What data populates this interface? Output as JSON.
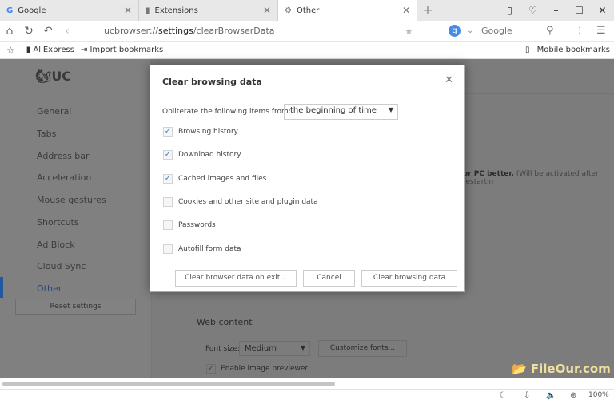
{
  "tabs": [
    {
      "label": "Google",
      "icon": "google-icon"
    },
    {
      "label": "Extensions",
      "icon": "puzzle-icon"
    },
    {
      "label": "Other",
      "icon": "gear-icon",
      "active": true
    }
  ],
  "address": {
    "scheme": "ucbrowser://",
    "path_bold": "settings",
    "path": "/clearBrowserData",
    "search_engine": "Google"
  },
  "bookmarks": {
    "items": [
      "AliExpress",
      "Import bookmarks"
    ],
    "mobile": "Mobile bookmarks"
  },
  "sidebar": {
    "logo": "UC",
    "items": [
      "General",
      "Tabs",
      "Address bar",
      "Acceleration",
      "Mouse gestures",
      "Shortcuts",
      "Ad Block",
      "Cloud Sync",
      "Other"
    ],
    "active": "Other",
    "reset": "Reset settings"
  },
  "background": {
    "note_bold": "or PC better.",
    "note": "(Will be activated after restartin",
    "web_content": "Web content",
    "font_size_label": "Font size:",
    "font_size_value": "Medium",
    "customize_fonts": "Customize fonts...",
    "image_previewer": "Enable image previewer"
  },
  "dialog": {
    "title": "Clear browsing data",
    "obliterate_label": "Obliterate the following items from:",
    "range": "the beginning of time",
    "options": [
      {
        "label": "Browsing history",
        "checked": true
      },
      {
        "label": "Download history",
        "checked": true
      },
      {
        "label": "Cached images and files",
        "checked": true
      },
      {
        "label": "Cookies and other site and plugin data",
        "checked": false
      },
      {
        "label": "Passwords",
        "checked": false
      },
      {
        "label": "Autofill form data",
        "checked": false
      }
    ],
    "buttons": {
      "on_exit": "Clear browser data on exit...",
      "cancel": "Cancel",
      "clear": "Clear browsing data"
    }
  },
  "status": {
    "zoom": "100%"
  },
  "watermark": "FileOur.com",
  "colors": {
    "accent": "#3d86d8",
    "overlay": "#7c7c7c",
    "active_nav": "#1f5aa0"
  }
}
